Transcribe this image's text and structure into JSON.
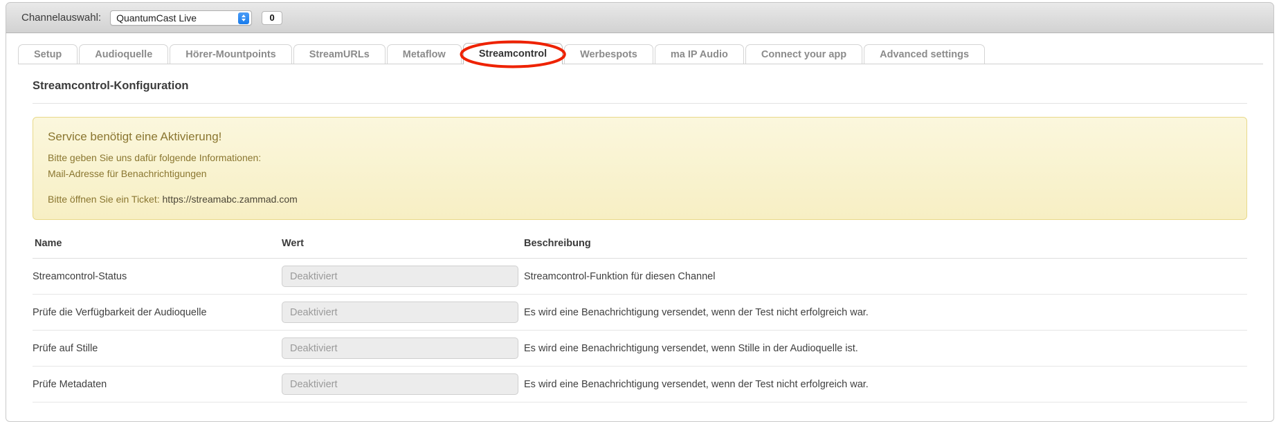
{
  "topbar": {
    "label": "Channelauswahl:",
    "channel_selected": "QuantumCast Live",
    "channel_options": [
      "QuantumCast Live"
    ],
    "count_value": "0",
    "stepper_icon": "stepper-up-down-icon"
  },
  "tabs": [
    {
      "label": "Setup",
      "active": false
    },
    {
      "label": "Audioquelle",
      "active": false
    },
    {
      "label": "Hörer-Mountpoints",
      "active": false
    },
    {
      "label": "StreamURLs",
      "active": false
    },
    {
      "label": "Metaflow",
      "active": false
    },
    {
      "label": "Streamcontrol",
      "active": true
    },
    {
      "label": "Werbespots",
      "active": false
    },
    {
      "label": "ma IP Audio",
      "active": false
    },
    {
      "label": "Connect your app",
      "active": false
    },
    {
      "label": "Advanced settings",
      "active": false
    }
  ],
  "annotation": {
    "type": "ellipse-highlight",
    "target": "Streamcontrol",
    "color": "#ee2200"
  },
  "main": {
    "page_title": "Streamcontrol-Konfiguration",
    "notice": {
      "title": "Service benötigt eine Aktivierung!",
      "lines": [
        "Bitte geben Sie uns dafür folgende Informationen:",
        "Mail-Adresse für Benachrichtigungen"
      ],
      "ticket_prefix": "Bitte öffnen Sie ein Ticket: ",
      "ticket_url": "https://streamabc.zammad.com",
      "bg_color": "#f8f1c9",
      "text_color": "#8a7630"
    },
    "table": {
      "headers": [
        "Name",
        "Wert",
        "Beschreibung"
      ],
      "rows": [
        {
          "name": "Streamcontrol-Status",
          "value": "",
          "value_placeholder": "Deaktiviert",
          "description": "Streamcontrol-Funktion für diesen Channel"
        },
        {
          "name": "Prüfe die Verfügbarkeit der Audioquelle",
          "value": "",
          "value_placeholder": "Deaktiviert",
          "description": "Es wird eine Benachrichtigung versendet, wenn der Test nicht erfolgreich war."
        },
        {
          "name": "Prüfe auf Stille",
          "value": "",
          "value_placeholder": "Deaktiviert",
          "description": "Es wird eine Benachrichtigung versendet, wenn Stille in der Audioquelle ist."
        },
        {
          "name": "Prüfe Metadaten",
          "value": "",
          "value_placeholder": "Deaktiviert",
          "description": "Es wird eine Benachrichtigung versendet, wenn der Test nicht erfolgreich war."
        }
      ]
    }
  }
}
